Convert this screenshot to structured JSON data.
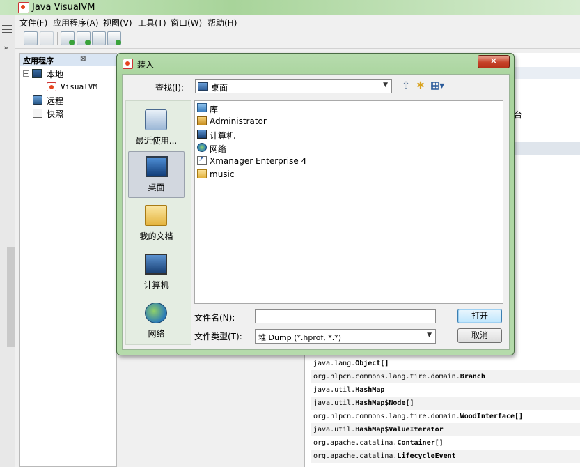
{
  "window": {
    "title": "Java VisualVM"
  },
  "menubar": [
    "文件(F)",
    "应用程序(A)",
    "视图(V)",
    "工具(T)",
    "窗口(W)",
    "帮助(H)"
  ],
  "explorer": {
    "tab_label": "应用程序",
    "tab_close": "⊠",
    "tree": {
      "local": "本地",
      "visualvm": "VisualVM",
      "remote": "远程",
      "snapshots": "快照"
    }
  },
  "background": {
    "partial_label": "台",
    "class_rows": [
      {
        "prefix": "java.lang.",
        "name": "Object[]"
      },
      {
        "prefix": "org.nlpcn.commons.lang.tire.domain.",
        "name": "Branch"
      },
      {
        "prefix": "java.util.",
        "name": "HashMap"
      },
      {
        "prefix": "java.util.",
        "name": "HashMap$Node[]"
      },
      {
        "prefix": "org.nlpcn.commons.lang.tire.domain.",
        "name": "WoodInterface[]"
      },
      {
        "prefix": "java.util.",
        "name": "HashMap$ValueIterator"
      },
      {
        "prefix": "org.apache.catalina.",
        "name": "Container[]"
      },
      {
        "prefix": "org.apache.catalina.",
        "name": "LifecycleEvent"
      }
    ]
  },
  "dialog": {
    "title": "装入",
    "close_glyph": "✕",
    "look_in_label": "查找(I):",
    "look_in_value": "桌面",
    "places": [
      {
        "label": "最近使用..."
      },
      {
        "label": "桌面"
      },
      {
        "label": "我的文档"
      },
      {
        "label": "计算机"
      },
      {
        "label": "网络"
      }
    ],
    "files": [
      {
        "name": "库",
        "icon": "library-icon"
      },
      {
        "name": "Administrator",
        "icon": "user-folder-icon"
      },
      {
        "name": "计算机",
        "icon": "computer-icon"
      },
      {
        "name": "网络",
        "icon": "network-icon"
      },
      {
        "name": "Xmanager Enterprise 4",
        "icon": "shortcut-icon"
      },
      {
        "name": "music",
        "icon": "folder-icon"
      }
    ],
    "filename_label": "文件名(N):",
    "filename_value": "",
    "filetype_label": "文件类型(T):",
    "filetype_value": "堆 Dump (*.hprof, *.*)",
    "open_button": "打开",
    "cancel_button": "取消"
  },
  "colors": {
    "dialog_frame": "#a9d49d",
    "close_button": "#c7442a",
    "selection": "#d2d7df"
  }
}
